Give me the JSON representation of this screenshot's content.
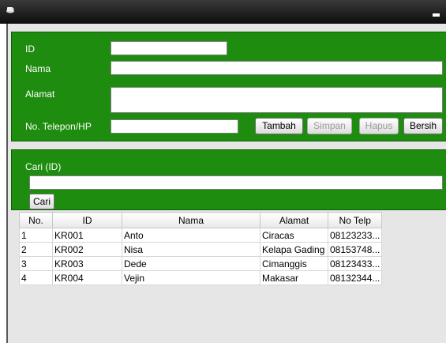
{
  "form": {
    "id_label": "ID",
    "nama_label": "Nama",
    "alamat_label": "Alamat",
    "telepon_label": "No. Telepon/HP",
    "id_value": "",
    "nama_value": "",
    "alamat_value": "",
    "telepon_value": "",
    "buttons": {
      "tambah": "Tambah",
      "simpan": "Simpan",
      "hapus": "Hapus",
      "bersih": "Bersih"
    }
  },
  "search": {
    "label": "Cari (ID)",
    "value": "",
    "button": "Cari"
  },
  "table": {
    "columns": [
      "No.",
      "ID",
      "Nama",
      "Alamat",
      "No Telp"
    ],
    "rows": [
      [
        "1",
        "KR001",
        "Anto",
        "Ciracas",
        "08123233..."
      ],
      [
        "2",
        "KR002",
        "Nisa",
        "Kelapa Gading",
        "08153748..."
      ],
      [
        "3",
        "KR003",
        "Dede",
        "Cimanggis",
        "08123433..."
      ],
      [
        "4",
        "KR004",
        "Vejin",
        "Makasar",
        "08132344..."
      ]
    ]
  },
  "icons": {
    "app": "coffee-cup-icon",
    "minimize": "minimize-icon"
  },
  "colors": {
    "panel": "#1e8c0e",
    "titlebar": "#1a1a1a",
    "window": "#e6e6e6"
  }
}
